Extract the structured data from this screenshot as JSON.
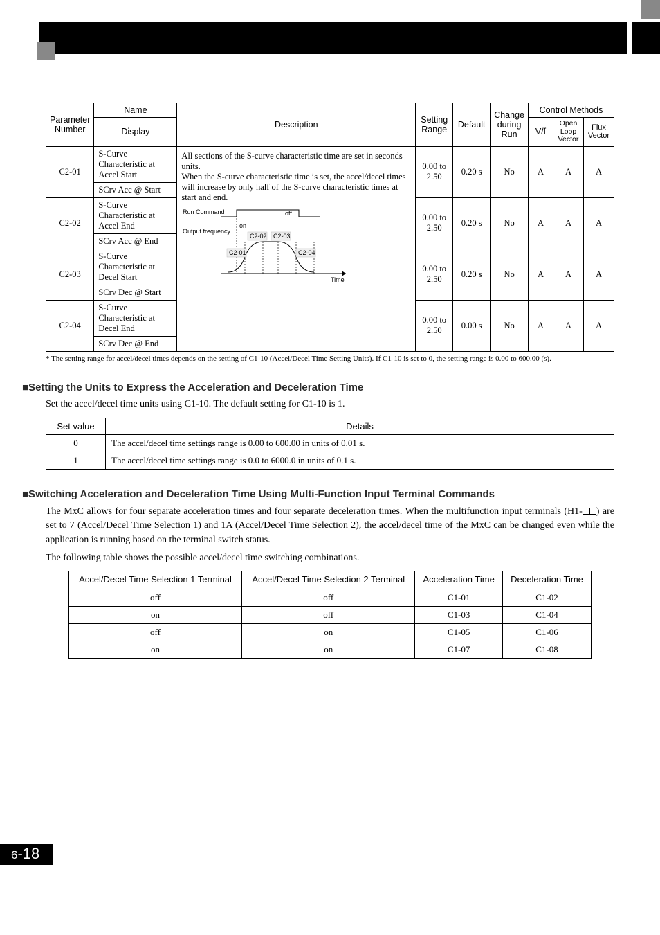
{
  "table1": {
    "headers": {
      "param": "Parameter Number",
      "name": "Name",
      "display": "Display",
      "desc": "Description",
      "range": "Setting Range",
      "default": "Default",
      "change": "Change during Run",
      "methods": "Control Methods",
      "vf": "V/f",
      "olv": "Open Loop Vector",
      "flux": "Flux Vector"
    },
    "desc_intro": "All sections of the S-curve characteristic time are set in seconds units.",
    "desc_body": "When the S-curve characteristic time is set, the accel/decel times will increase by only half of the S-curve characteristic times at start and end.",
    "diagram": {
      "run": "Run Command",
      "on": "on",
      "off": "off",
      "out": "Output frequency",
      "c201": "C2-01",
      "c202": "C2-02",
      "c203": "C2-03",
      "c204": "C2-04",
      "time": "Time"
    },
    "rows": [
      {
        "num": "C2-01",
        "name": "S-Curve Characteristic at Accel Start",
        "disp": "SCrv Acc @ Start",
        "range": "0.00 to 2.50",
        "def": "0.20 s",
        "chg": "No",
        "vf": "A",
        "olv": "A",
        "flux": "A"
      },
      {
        "num": "C2-02",
        "name": "S-Curve Characteristic at Accel End",
        "disp": "SCrv Acc @ End",
        "range": "0.00 to 2.50",
        "def": "0.20 s",
        "chg": "No",
        "vf": "A",
        "olv": "A",
        "flux": "A"
      },
      {
        "num": "C2-03",
        "name": "S-Curve Characteristic at Decel Start",
        "disp": "SCrv Dec @ Start",
        "range": "0.00 to 2.50",
        "def": "0.20 s",
        "chg": "No",
        "vf": "A",
        "olv": "A",
        "flux": "A"
      },
      {
        "num": "C2-04",
        "name": "S-Curve Characteristic at Decel End",
        "disp": "SCrv Dec @ End",
        "range": "0.00 to 2.50",
        "def": "0.00 s",
        "chg": "No",
        "vf": "A",
        "olv": "A",
        "flux": "A"
      }
    ],
    "footnote": "*  The setting range for accel/decel times depends on the setting of C1-10 (Accel/Decel Time Setting Units). If C1-10 is set to 0, the setting range is 0.00 to 600.00 (s)."
  },
  "units_section": {
    "title": "■Setting the Units to Express the Acceleration and Deceleration Time",
    "intro": "Set the accel/decel time units using C1-10. The default setting for C1-10 is 1.",
    "headers": {
      "setvalue": "Set value",
      "details": "Details"
    },
    "rows": [
      {
        "v": "0",
        "d": "The accel/decel time settings range is 0.00 to 600.00 in units of 0.01 s."
      },
      {
        "v": "1",
        "d": "The accel/decel time settings range is 0.0 to 6000.0 in units of 0.1 s."
      }
    ]
  },
  "switch_section": {
    "title": "■Switching Acceleration and Deceleration Time Using Multi-Function Input Terminal Commands",
    "p1a": "The MxC allows for four separate acceleration times and four separate deceleration times. When the multifunction input terminals (H1-",
    "p1b": ") are set to 7 (Accel/Decel Time Selection 1) and 1A (Accel/Decel Time Selection 2), the accel/decel time of the MxC can be changed even while the application is running based on the terminal switch status.",
    "p2": "The following table shows the possible accel/decel time switching combinations.",
    "headers": {
      "sel1": "Accel/Decel Time Selection 1 Terminal",
      "sel2": "Accel/Decel Time Selection 2 Terminal",
      "acc": "Acceleration Time",
      "dec": "Deceleration Time"
    },
    "rows": [
      {
        "s1": "off",
        "s2": "off",
        "a": "C1-01",
        "d": "C1-02"
      },
      {
        "s1": "on",
        "s2": "off",
        "a": "C1-03",
        "d": "C1-04"
      },
      {
        "s1": "off",
        "s2": "on",
        "a": "C1-05",
        "d": "C1-06"
      },
      {
        "s1": "on",
        "s2": "on",
        "a": "C1-07",
        "d": "C1-08"
      }
    ]
  },
  "page": {
    "chapter": "6",
    "sep": "-",
    "num": "18"
  }
}
